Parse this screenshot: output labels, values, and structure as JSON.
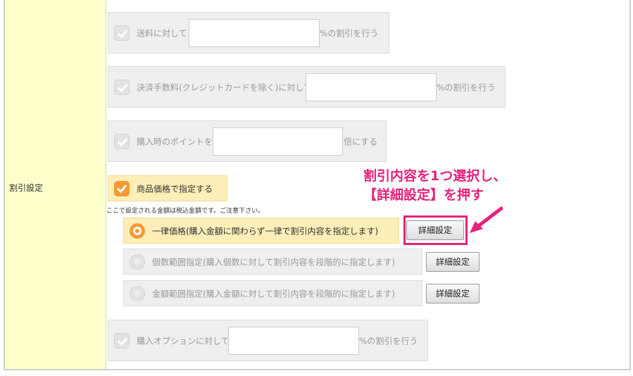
{
  "section_label": "割引設定",
  "options": [
    {
      "label": "送料に対して",
      "suffix": "%の割引を行う",
      "value": ""
    },
    {
      "label": "決済手数料(クレジットカードを除く)に対して",
      "suffix": "%の割引を行う",
      "value": ""
    },
    {
      "label": "購入時のポイントを",
      "suffix": "倍にする",
      "value": ""
    }
  ],
  "product_price": {
    "label": "商品価格で指定する",
    "checked": true
  },
  "note": "ここで設定される金額は税込金額です。ご注意下さい。",
  "radios": [
    {
      "label": "一律価格(購入金額に関わらず一律で割引内容を指定します)",
      "selected": true,
      "button": "詳細設定"
    },
    {
      "label": "個数範囲指定(購入個数に対して割引内容を段階的に指定します)",
      "selected": false,
      "button": "詳細設定"
    },
    {
      "label": "金額範囲指定(購入金額に対して割引内容を段階的に指定します)",
      "selected": false,
      "button": "詳細設定"
    }
  ],
  "purchase_option": {
    "label": "購入オプションに対して",
    "suffix": "%の割引を行う",
    "value": ""
  },
  "annotation": {
    "line1": "割引内容を1つ選択し、",
    "line2": "【詳細設定】を押す",
    "color": "#e5227a"
  },
  "colors": {
    "accent": "#f39a32",
    "label_bg": "#ffffcc",
    "highlight_bg": "#fdeeb8"
  }
}
